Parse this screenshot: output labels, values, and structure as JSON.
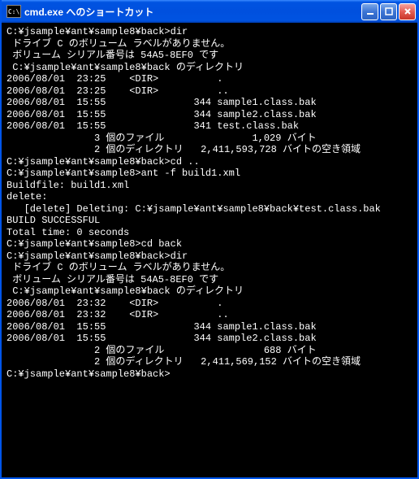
{
  "title": "cmd.exe へのショートカット",
  "icon_text": "C:\\",
  "lines": [
    "",
    "C:¥jsample¥ant¥sample8¥back>dir",
    " ドライブ C のボリューム ラベルがありません。",
    " ボリューム シリアル番号は 54A5-8EF0 です",
    "",
    " C:¥jsample¥ant¥sample8¥back のディレクトリ",
    "",
    "2006/08/01  23:25    <DIR>          .",
    "2006/08/01  23:25    <DIR>          ..",
    "2006/08/01  15:55               344 sample1.class.bak",
    "2006/08/01  15:55               344 sample2.class.bak",
    "2006/08/01  15:55               341 test.class.bak",
    "               3 個のファイル               1,029 バイト",
    "               2 個のディレクトリ   2,411,593,728 バイトの空き領域",
    "",
    "C:¥jsample¥ant¥sample8¥back>cd ..",
    "",
    "C:¥jsample¥ant¥sample8>ant -f build1.xml",
    "Buildfile: build1.xml",
    "",
    "delete:",
    "   [delete] Deleting: C:¥jsample¥ant¥sample8¥back¥test.class.bak",
    "",
    "BUILD SUCCESSFUL",
    "Total time: 0 seconds",
    "C:¥jsample¥ant¥sample8>cd back",
    "",
    "C:¥jsample¥ant¥sample8¥back>dir",
    " ドライブ C のボリューム ラベルがありません。",
    " ボリューム シリアル番号は 54A5-8EF0 です",
    "",
    " C:¥jsample¥ant¥sample8¥back のディレクトリ",
    "",
    "2006/08/01  23:32    <DIR>          .",
    "2006/08/01  23:32    <DIR>          ..",
    "2006/08/01  15:55               344 sample1.class.bak",
    "2006/08/01  15:55               344 sample2.class.bak",
    "               2 個のファイル                 688 バイト",
    "               2 個のディレクトリ   2,411,569,152 バイトの空き領域",
    "",
    "C:¥jsample¥ant¥sample8¥back>"
  ]
}
